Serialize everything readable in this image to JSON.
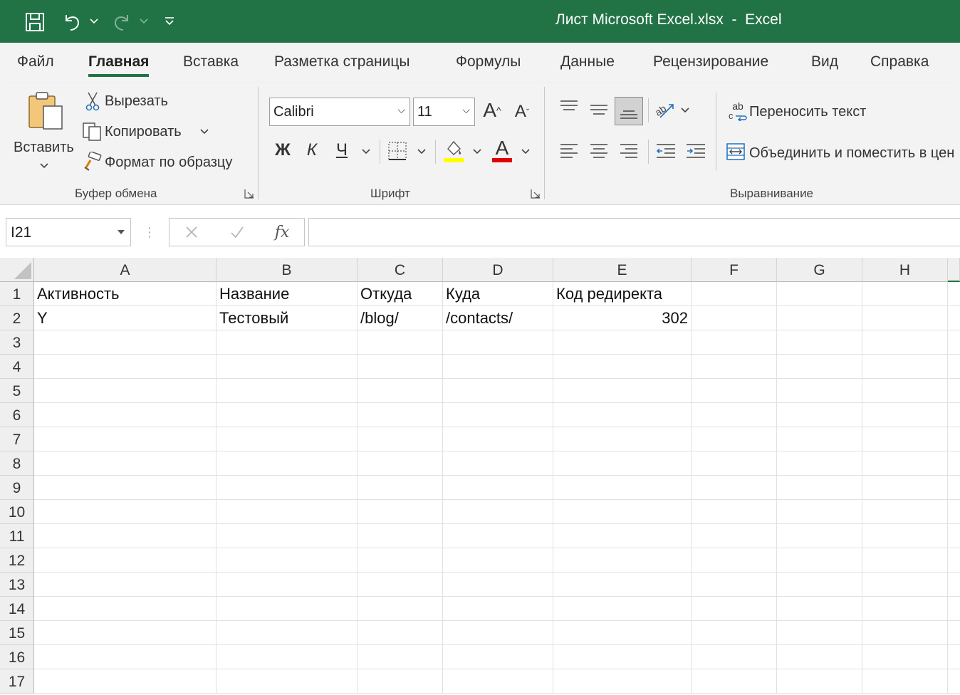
{
  "title": {
    "text": "Лист Microsoft Excel.xlsx  -  Excel"
  },
  "colors": {
    "accent": "#217346",
    "highlight": "#ffff00",
    "font_color": "#e00000"
  },
  "qat_icons": [
    "save-icon",
    "undo-icon",
    "redo-icon",
    "customize-qat-icon"
  ],
  "tabs": [
    {
      "label": "Файл",
      "active": false
    },
    {
      "label": "Главная",
      "active": true
    },
    {
      "label": "Вставка",
      "active": false
    },
    {
      "label": "Разметка страницы",
      "active": false
    },
    {
      "label": "Формулы",
      "active": false
    },
    {
      "label": "Данные",
      "active": false
    },
    {
      "label": "Рецензирование",
      "active": false
    },
    {
      "label": "Вид",
      "active": false
    },
    {
      "label": "Справка",
      "active": false
    }
  ],
  "clipboard": {
    "paste_label": "Вставить",
    "cut_label": "Вырезать",
    "copy_label": "Копировать",
    "format_painter_label": "Формат по образцу",
    "group_label": "Буфер обмена"
  },
  "font": {
    "font_name": "Calibri",
    "font_size": "11",
    "bold": "Ж",
    "italic": "К",
    "underline": "Ч",
    "grow_glyph": "A",
    "shrink_glyph": "A",
    "font_color_glyph": "A",
    "group_label": "Шрифт"
  },
  "alignment": {
    "wrap_text_label": "Переносить текст",
    "wrap_icon_text": "ab",
    "merge_label": "Объединить и поместить в цен",
    "group_label": "Выравнивание"
  },
  "formula_bar": {
    "name_box": "I21",
    "fx_label": "fx",
    "formula": ""
  },
  "sheet": {
    "columns": [
      "A",
      "B",
      "C",
      "D",
      "E",
      "F",
      "G",
      "H"
    ],
    "rows": [
      "1",
      "2",
      "3",
      "4",
      "5",
      "6",
      "7",
      "8",
      "9",
      "10",
      "11",
      "12",
      "13",
      "14",
      "15",
      "16",
      "17"
    ],
    "cells": [
      [
        "Активность",
        "Название",
        "Откуда",
        "Куда",
        "Код редиректа",
        "",
        "",
        ""
      ],
      [
        "Y",
        "Тестовый",
        "/blog/",
        "/contacts/",
        "302",
        "",
        "",
        ""
      ]
    ]
  }
}
